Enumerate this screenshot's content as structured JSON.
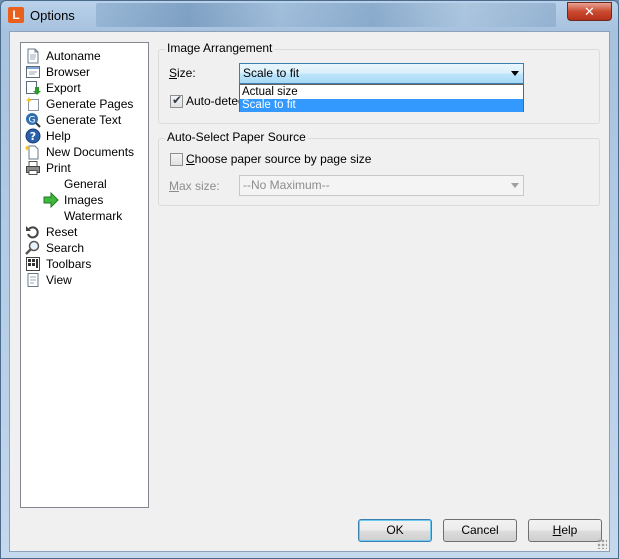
{
  "window": {
    "title": "Options",
    "app_icon_letter": "L",
    "close_glyph": "✕"
  },
  "tree": {
    "items": [
      {
        "label": "Autoname",
        "icon": "document-icon"
      },
      {
        "label": "Browser",
        "icon": "browser-icon"
      },
      {
        "label": "Export",
        "icon": "export-icon"
      },
      {
        "label": "Generate Pages",
        "icon": "generate-pages-icon"
      },
      {
        "label": "Generate Text",
        "icon": "generate-text-icon"
      },
      {
        "label": "Help",
        "icon": "help-icon"
      },
      {
        "label": "New Documents",
        "icon": "new-documents-icon"
      },
      {
        "label": "Print",
        "icon": "printer-icon"
      },
      {
        "label": "General",
        "icon": ""
      },
      {
        "label": "Images",
        "icon": "green-arrow-icon"
      },
      {
        "label": "Watermark",
        "icon": ""
      },
      {
        "label": "Reset",
        "icon": "reset-icon"
      },
      {
        "label": "Search",
        "icon": "search-icon"
      },
      {
        "label": "Toolbars",
        "icon": "toolbars-icon"
      },
      {
        "label": "View",
        "icon": "view-icon"
      }
    ],
    "selected": "Images"
  },
  "image_arrangement": {
    "title": "Image Arrangement",
    "size_label_u": "S",
    "size_label_rest": "ize:",
    "size_value": "Scale to fit",
    "options": [
      "Actual size",
      "Scale to fit"
    ],
    "selected_option": "Scale to fit",
    "auto_detect_label": "Auto-detec",
    "auto_detect_checked": true
  },
  "paper_source": {
    "title": "Auto-Select Paper Source",
    "choose_label_u": "C",
    "choose_label_rest": "hoose paper source by page size",
    "choose_checked": false,
    "max_size_label_u": "M",
    "max_size_label_rest": "ax size:",
    "max_size_value": "--No Maximum--"
  },
  "buttons": {
    "ok": "OK",
    "cancel": "Cancel",
    "help_u": "H",
    "help_rest": "elp"
  },
  "colors": {
    "selection": "#3399ff",
    "close": "#c94a2f",
    "app_icon": "#e8601c"
  }
}
